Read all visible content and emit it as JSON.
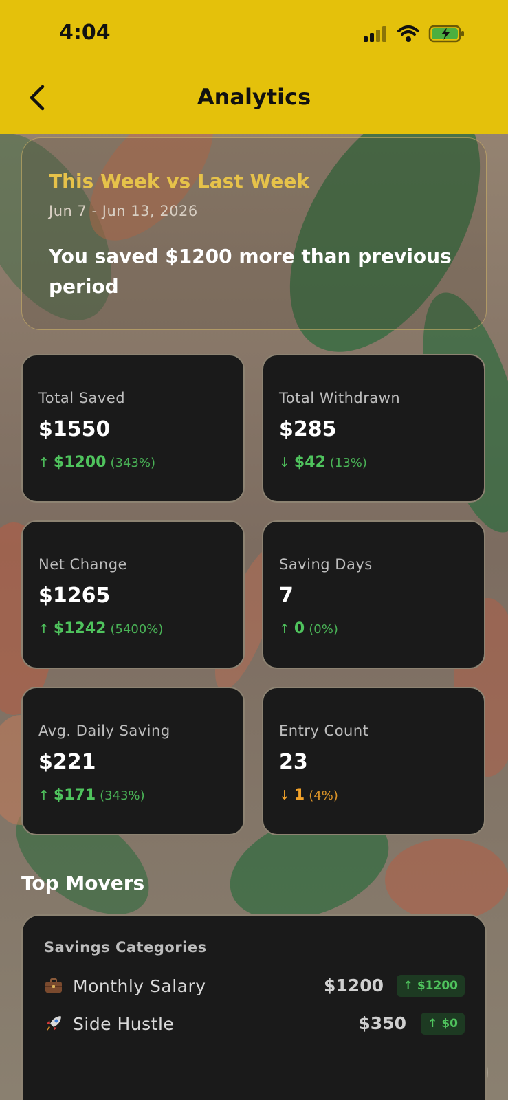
{
  "status_bar": {
    "time": "4:04"
  },
  "header": {
    "title": "Analytics"
  },
  "summary": {
    "heading": "This Week vs Last Week",
    "range": "Jun 7 - Jun 13, 2026",
    "message": "You saved $1200 more than previous period"
  },
  "stats": [
    {
      "label": "Total Saved",
      "value": "$1550",
      "arrow": "↑",
      "amount": "$1200",
      "pct": "(343%)",
      "color": "#4fc35d"
    },
    {
      "label": "Total Withdrawn",
      "value": "$285",
      "arrow": "↓",
      "amount": "$42",
      "pct": "(13%)",
      "color": "#4fc35d"
    },
    {
      "label": "Net Change",
      "value": "$1265",
      "arrow": "↑",
      "amount": "$1242",
      "pct": "(5400%)",
      "color": "#4fc35d"
    },
    {
      "label": "Saving Days",
      "value": "7",
      "arrow": "↑",
      "amount": "0",
      "pct": "(0%)",
      "color": "#4fc35d"
    },
    {
      "label": "Avg. Daily Saving",
      "value": "$221",
      "arrow": "↑",
      "amount": "$171",
      "pct": "(343%)",
      "color": "#4fc35d"
    },
    {
      "label": "Entry Count",
      "value": "23",
      "arrow": "↓",
      "amount": "1",
      "pct": "(4%)",
      "color": "#f2a22a"
    }
  ],
  "top_movers": {
    "title": "Top Movers",
    "card_label": "Savings Categories",
    "items": [
      {
        "icon": "briefcase-icon",
        "name": "Monthly Salary",
        "amount": "$1200",
        "badge_arrow": "↑",
        "badge": "$1200"
      },
      {
        "icon": "rocket-icon",
        "name": "Side Hustle",
        "amount": "$350",
        "badge_arrow": "↑",
        "badge": "$0"
      }
    ]
  },
  "colors": {
    "header": "#e4c10b",
    "accent": "#e6c24a",
    "positive": "#4fc35d",
    "negative": "#f2a22a",
    "card": "#1a1a1a"
  }
}
